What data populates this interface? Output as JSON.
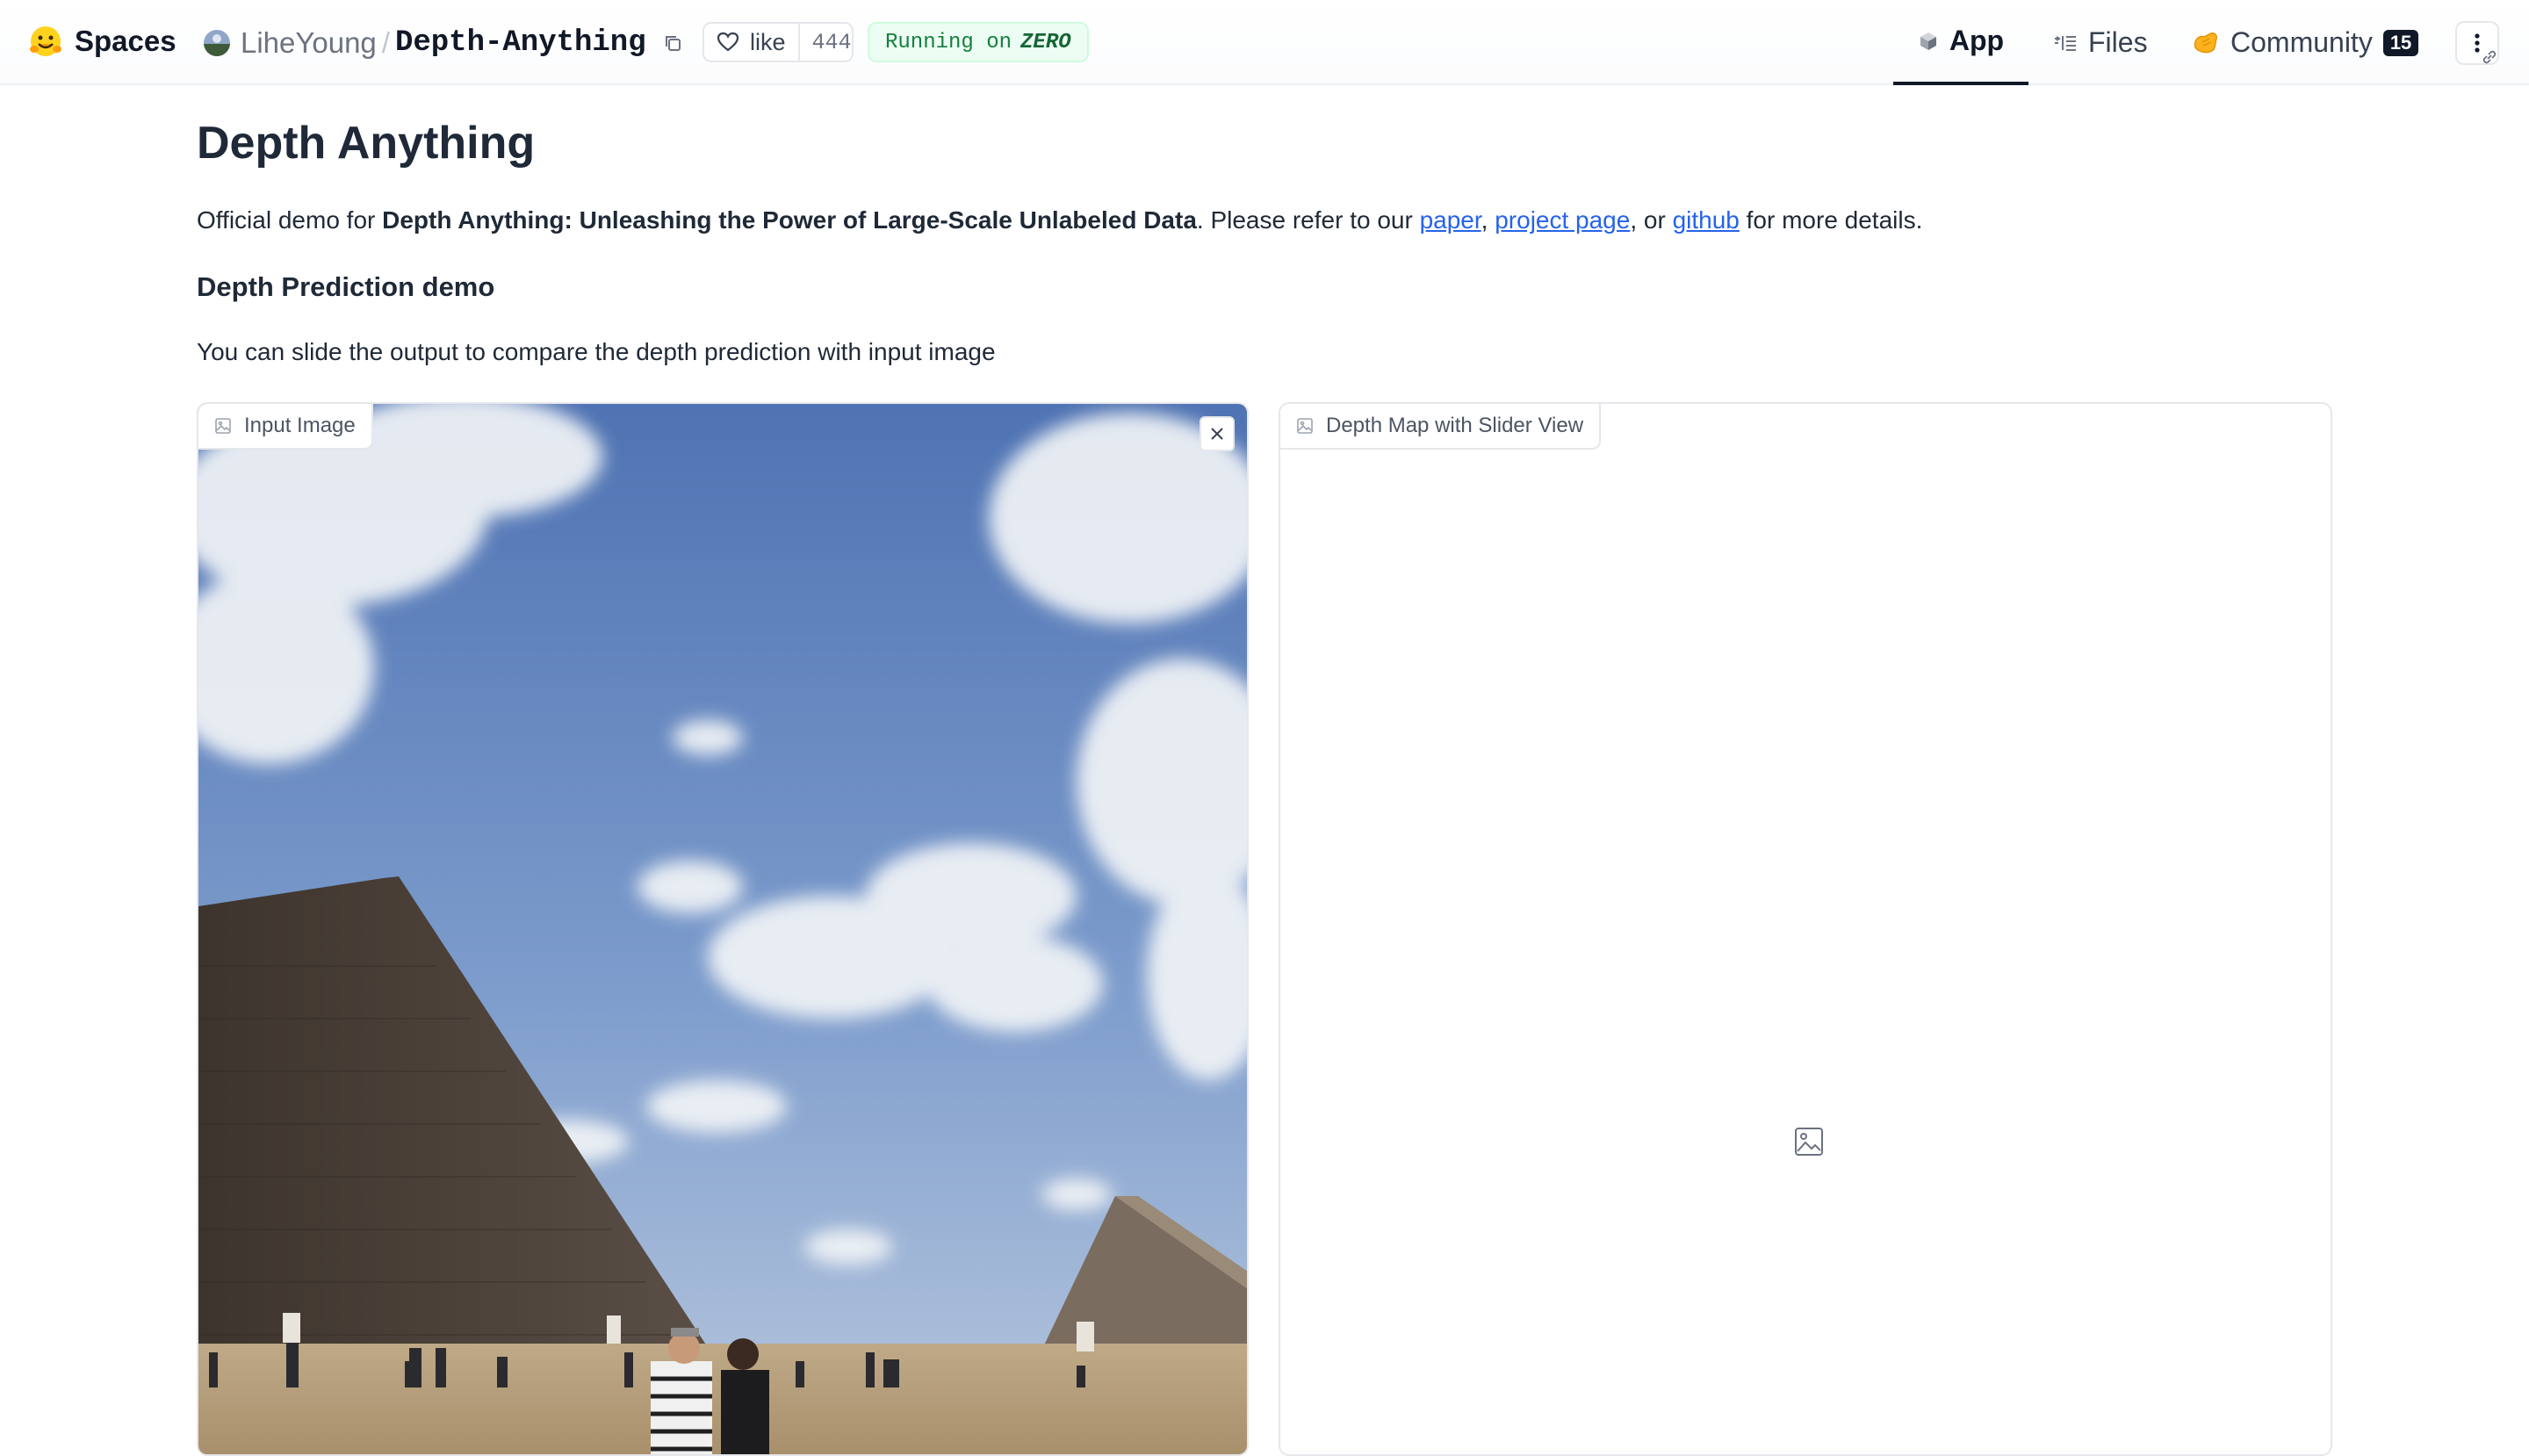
{
  "header": {
    "brand": "Spaces",
    "owner": "LiheYoung",
    "separator": "/",
    "repo": "Depth-Anything",
    "like_label": "like",
    "like_count": "444",
    "status_prefix": "Running on",
    "status_hardware": "ZERO",
    "tabs": [
      {
        "label": "App",
        "icon": "cube-icon",
        "active": true
      },
      {
        "label": "Files",
        "icon": "files-icon",
        "active": false
      },
      {
        "label": "Community",
        "icon": "community-icon",
        "active": false,
        "count": "15"
      }
    ]
  },
  "main": {
    "title": "Depth Anything",
    "intro": {
      "prefix": "Official demo for ",
      "paper_title": "Depth Anything: Unleashing the Power of Large-Scale Unlabeled Data",
      "middle": ". Please refer to our ",
      "link_paper": "paper",
      "sep1": ", ",
      "link_project": "project page",
      "sep2": ", or ",
      "link_github": "github",
      "suffix": " for more details."
    },
    "subheading": "Depth Prediction demo",
    "hint": "You can slide the output to compare the depth prediction with input image",
    "input_panel": {
      "label": "Input Image",
      "icon": "image-icon"
    },
    "output_panel": {
      "label": "Depth Map with Slider View",
      "icon": "image-icon",
      "placeholder_icon": "image-placeholder-icon"
    }
  },
  "colors": {
    "accent_link": "#2563eb",
    "status_green": "#15803d",
    "sky": "#6b8fc7",
    "pyramid": "#4a4038",
    "sand": "#b8a17e"
  }
}
